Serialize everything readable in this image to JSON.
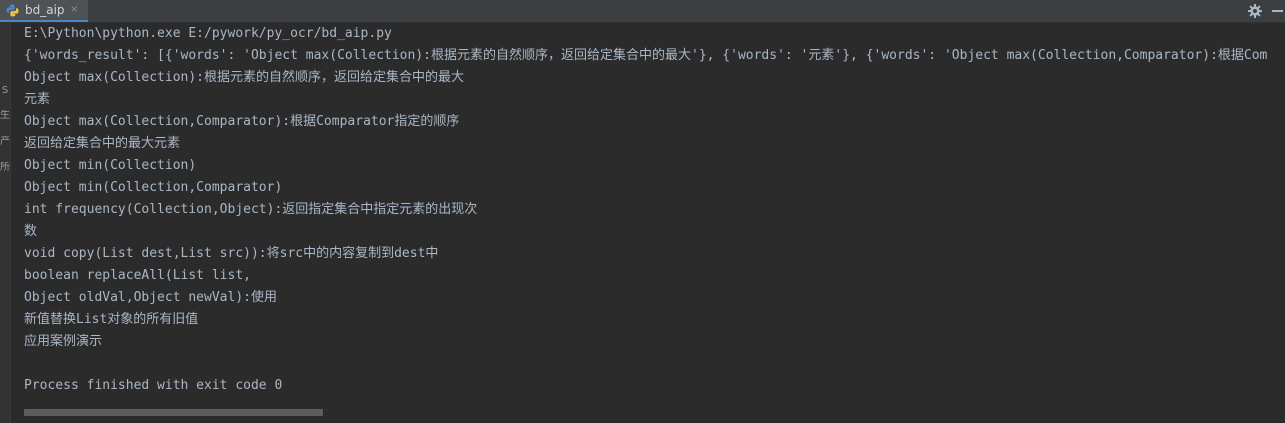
{
  "tab": {
    "label": "bd_aip",
    "close_label": "×",
    "icon": "python-file-icon"
  },
  "toolbar": {
    "settings_icon": "gear-icon",
    "minimize_icon": "minimize-icon"
  },
  "gutter": {
    "glyphs": [
      "S",
      "生",
      "产",
      "所"
    ]
  },
  "console": {
    "lines": [
      "E:\\Python\\python.exe E:/pywork/py_ocr/bd_aip.py",
      "{'words_result': [{'words': 'Object max(Collection):根据元素的自然顺序，返回给定集合中的最大'}, {'words': '元素'}, {'words': 'Object max(Collection,Comparator):根据Com",
      "Object max(Collection):根据元素的自然顺序，返回给定集合中的最大",
      "元素",
      "Object max(Collection,Comparator):根据Comparator指定的顺序",
      "返回给定集合中的最大元素",
      "Object min(Collection)",
      "Object min(Collection,Comparator)",
      "int frequency(Collection,Object):返回指定集合中指定元素的出现次",
      "数",
      "void copy(List dest,List src)):将src中的内容复制到dest中",
      "boolean replaceAll(List list,",
      "Object oldVal,Object newVal):使用",
      "新值替换List对象的所有旧值",
      "应用案例演示",
      "",
      "Process finished with exit code 0"
    ]
  },
  "colors": {
    "background": "#2b2b2b",
    "text": "#a9b7c6",
    "tab_accent": "#4a88c7"
  }
}
